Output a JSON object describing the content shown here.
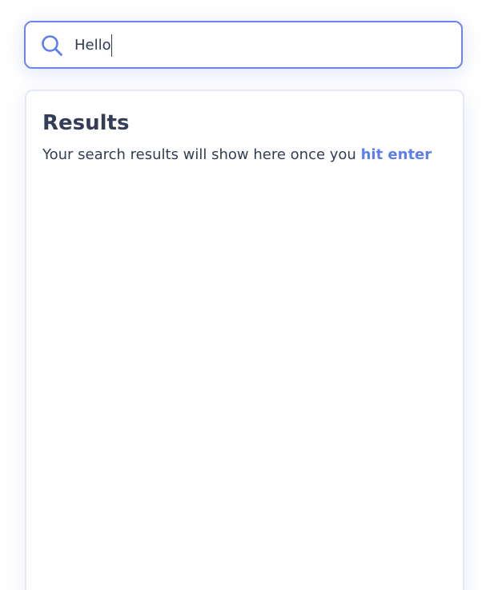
{
  "search": {
    "value": "Hello",
    "icon": "search-icon"
  },
  "results": {
    "title": "Results",
    "hint_text": "Your search results will show here once you",
    "hint_link": "hit enter"
  },
  "colors": {
    "accent": "#5e7df0",
    "text": "#343d58",
    "border": "#6b84ee"
  }
}
